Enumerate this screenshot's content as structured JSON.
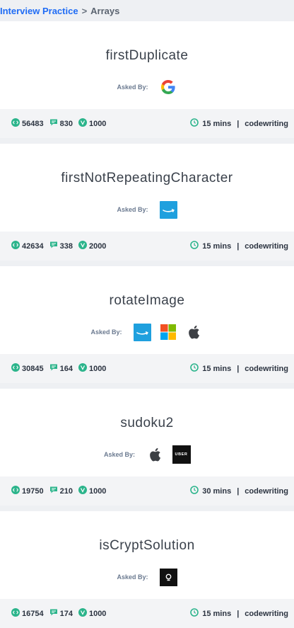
{
  "breadcrumb": {
    "link": "Interview Practice",
    "separator": ">",
    "current": "Arrays"
  },
  "asked_by_label": "Asked By:",
  "tasks": [
    {
      "title": "firstDuplicate",
      "companies": [
        "google-logo"
      ],
      "solutions": "56483",
      "comments": "830",
      "points": "1000",
      "time": "15 mins",
      "type": "codewriting"
    },
    {
      "title": "firstNotRepeatingCharacter",
      "companies": [
        "amazon-logo"
      ],
      "solutions": "42634",
      "comments": "338",
      "points": "2000",
      "time": "15 mins",
      "type": "codewriting"
    },
    {
      "title": "rotateImage",
      "companies": [
        "amazon-logo",
        "microsoft-logo",
        "apple-logo"
      ],
      "solutions": "30845",
      "comments": "164",
      "points": "1000",
      "time": "15 mins",
      "type": "codewriting"
    },
    {
      "title": "sudoku2",
      "companies": [
        "apple-logo",
        "uber-logo"
      ],
      "solutions": "19750",
      "comments": "210",
      "points": "1000",
      "time": "30 mins",
      "type": "codewriting"
    },
    {
      "title": "isCryptSolution",
      "companies": [
        "dark-logo"
      ],
      "solutions": "16754",
      "comments": "174",
      "points": "1000",
      "time": "15 mins",
      "type": "codewriting"
    }
  ],
  "logo_text": {
    "uber": "UBER"
  },
  "colors": {
    "accent": "#1f6cf5",
    "icon_green": "#2bb48b",
    "amazon_blue": "#1fa0de"
  }
}
